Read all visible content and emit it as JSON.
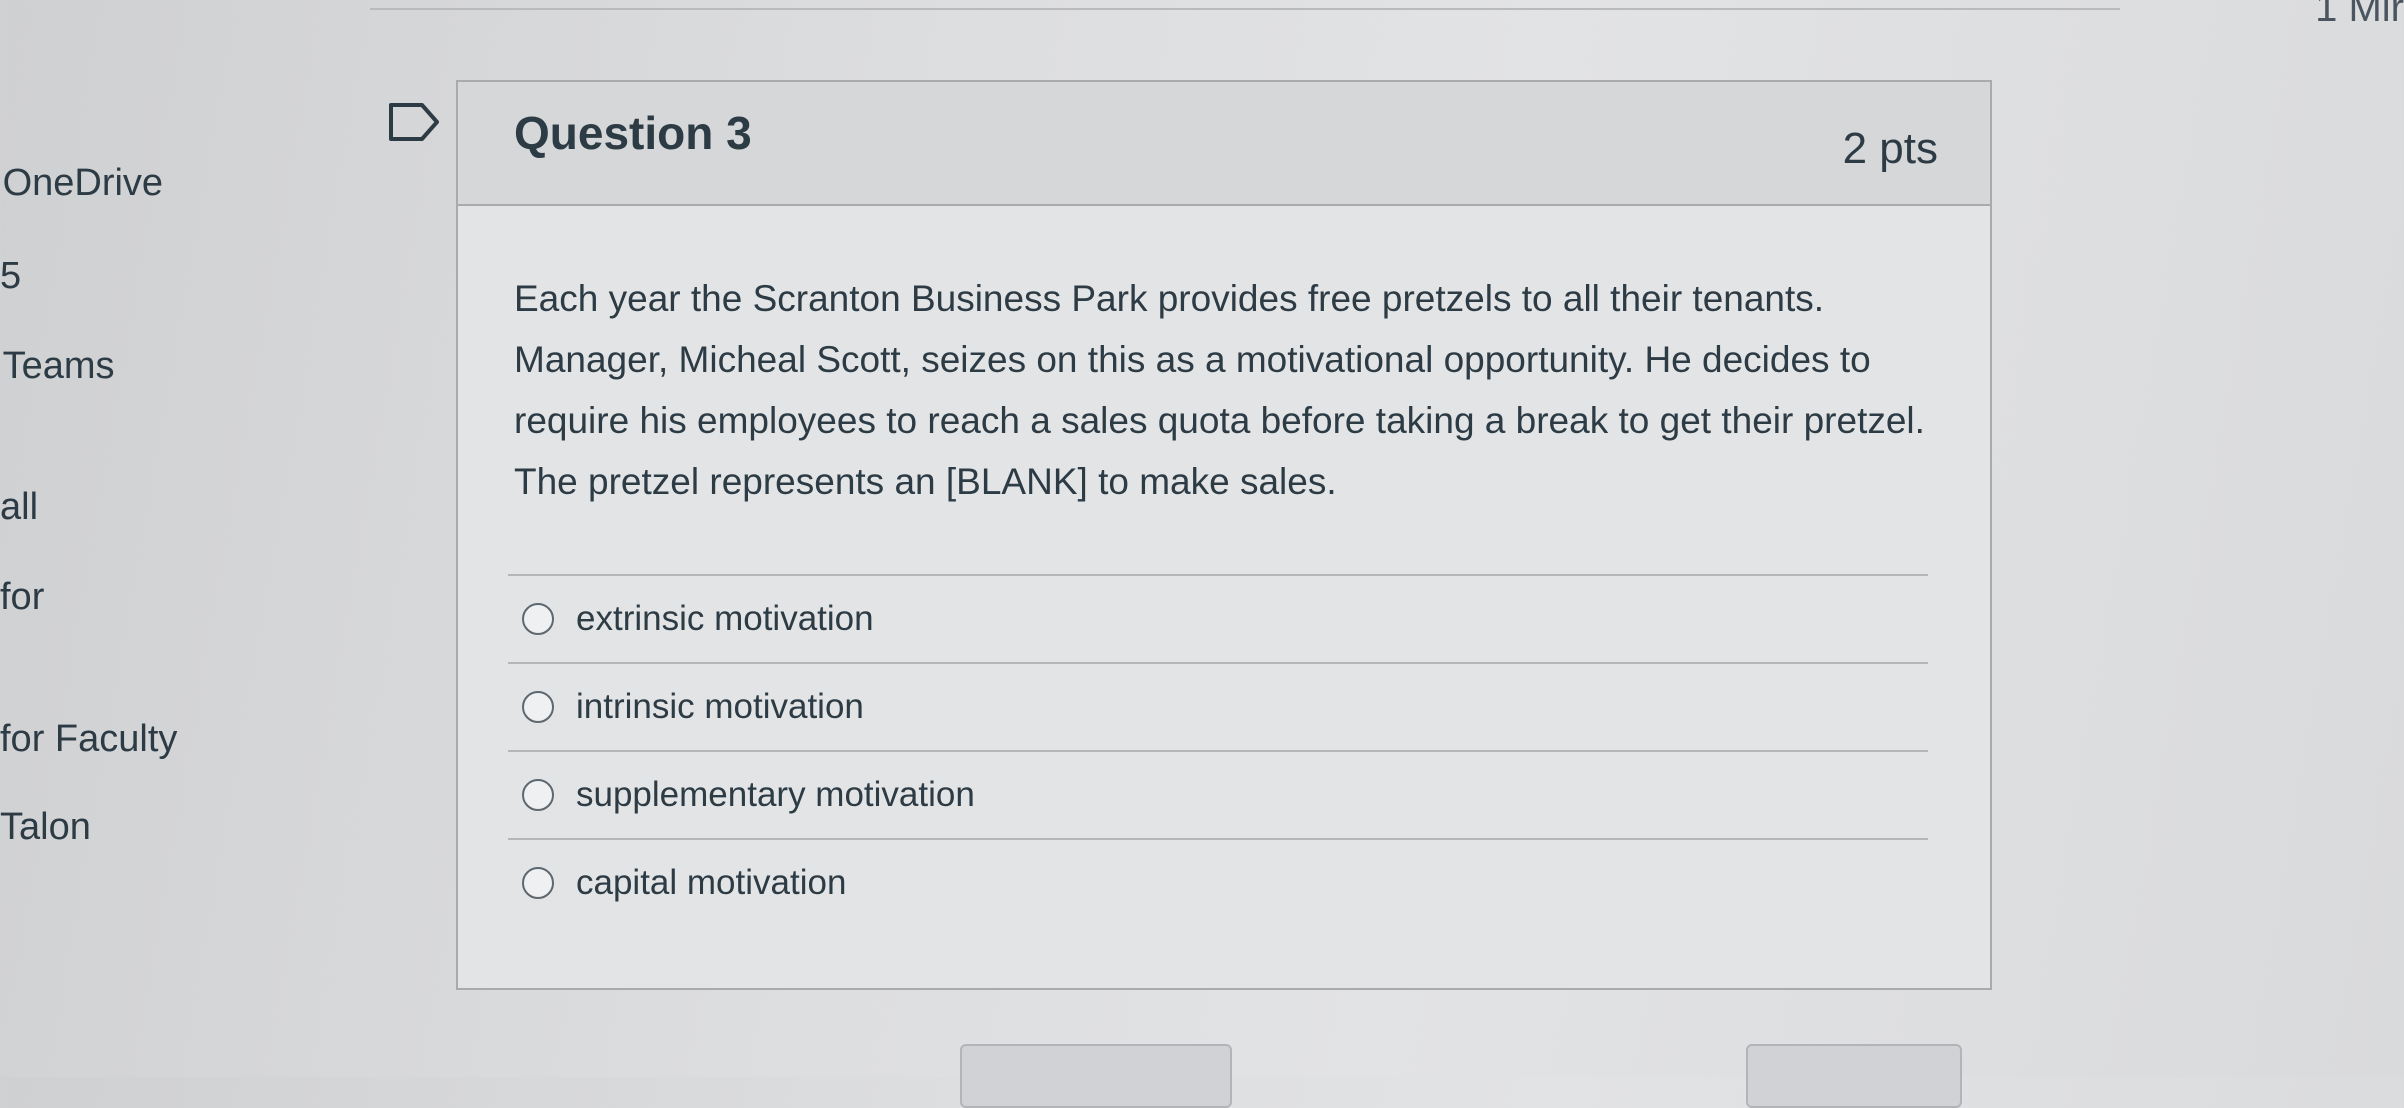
{
  "timer": {
    "text": "1 Mir"
  },
  "sidebar": {
    "items": [
      {
        "label": "OneDrive",
        "prefix": ":"
      },
      {
        "label": "5"
      },
      {
        "label": "Teams",
        "prefix": ":"
      },
      {
        "label": "all"
      },
      {
        "label": "for"
      },
      {
        "label": "for Faculty"
      },
      {
        "label": "Talon"
      }
    ]
  },
  "question": {
    "title": "Question 3",
    "points": "2 pts",
    "text": "Each year the Scranton Business Park provides free pretzels to all their tenants. Manager, Micheal Scott, seizes on this as a motivational opportunity.  He decides to require his employees to reach a sales quota before taking a break to get their pretzel.  The pretzel represents an [BLANK] to make sales.",
    "answers": [
      {
        "label": "extrinsic motivation",
        "selected": false
      },
      {
        "label": "intrinsic motivation",
        "selected": false
      },
      {
        "label": "supplementary motivation",
        "selected": false
      },
      {
        "label": "capital motivation",
        "selected": false
      }
    ]
  },
  "colors": {
    "text": "#2d3b45",
    "card_bg": "#e3e4e6",
    "header_bg": "#d6d7d9",
    "border": "#a8aaad"
  },
  "icons": {
    "flag": "flag-icon",
    "radio": "radio-empty-icon"
  }
}
